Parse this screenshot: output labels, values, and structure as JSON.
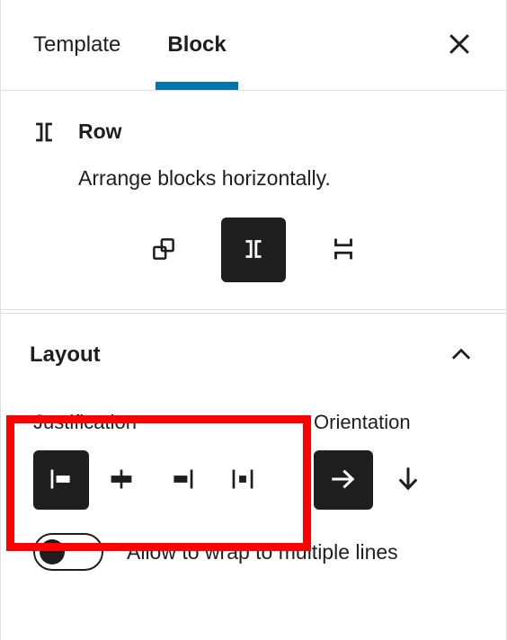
{
  "header": {
    "tabs": [
      {
        "label": "Template",
        "selected": false
      },
      {
        "label": "Block",
        "selected": true
      }
    ],
    "close_label": "Close settings",
    "accent_color": "#0275aa"
  },
  "block_card": {
    "icon": "row-icon",
    "title": "Row",
    "description": "Arrange blocks horizontally.",
    "variations": [
      {
        "name": "Group",
        "icon": "group-icon",
        "selected": false
      },
      {
        "name": "Row",
        "icon": "row-icon",
        "selected": true
      },
      {
        "name": "Stack",
        "icon": "stack-icon",
        "selected": false
      }
    ]
  },
  "layout_panel": {
    "title": "Layout",
    "collapse_icon": "chevron-up-icon",
    "expanded": true,
    "justification": {
      "label": "Justification",
      "options": [
        {
          "name": "Justify items left",
          "icon": "justify-left-icon",
          "selected": true
        },
        {
          "name": "Justify items center",
          "icon": "justify-center-icon",
          "selected": false
        },
        {
          "name": "Justify items right",
          "icon": "justify-right-icon",
          "selected": false
        },
        {
          "name": "Space between items",
          "icon": "justify-space-between-icon",
          "selected": false
        }
      ]
    },
    "orientation": {
      "label": "Orientation",
      "options": [
        {
          "name": "Horizontal",
          "icon": "arrow-right-icon",
          "selected": true
        },
        {
          "name": "Vertical",
          "icon": "arrow-down-icon",
          "selected": false
        }
      ]
    },
    "wrap_toggle": {
      "label": "Allow to wrap to multiple lines",
      "checked": false
    }
  },
  "annotation": {
    "highlight_color": "#ff0000",
    "target": "justification-control"
  }
}
